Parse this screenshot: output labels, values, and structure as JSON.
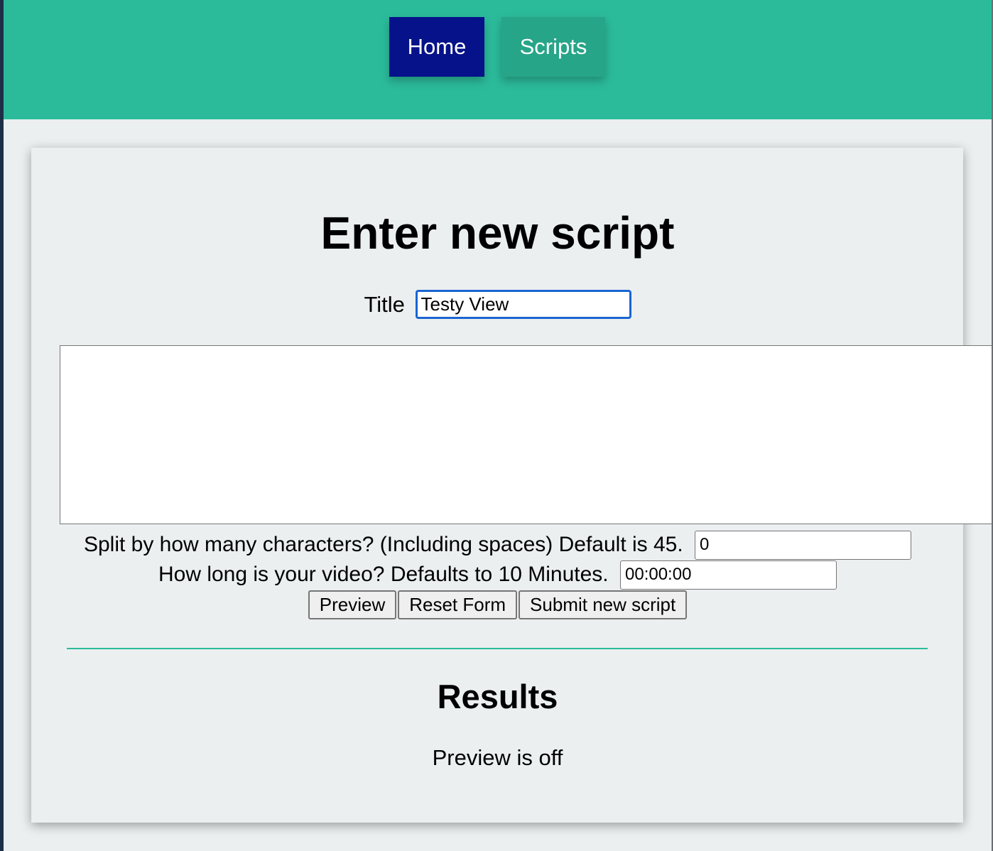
{
  "nav": {
    "home_label": "Home",
    "scripts_label": "Scripts"
  },
  "form": {
    "heading": "Enter new script",
    "title_label": "Title",
    "title_value": "Testy View",
    "script_text": "",
    "split_label": "Split by how many characters? (Including spaces) Default is 45.",
    "split_value": "0",
    "length_label": "How long is your video? Defaults to 10 Minutes.",
    "length_value": "00:00:00",
    "preview_button": "Preview",
    "reset_button": "Reset Form",
    "submit_button": "Submit new script"
  },
  "results": {
    "heading": "Results",
    "status": "Preview is off"
  },
  "colors": {
    "header_bg": "#2bbb9b",
    "home_active": "#051289",
    "scripts_button": "#27a588",
    "page_bg": "#ebeff0"
  }
}
